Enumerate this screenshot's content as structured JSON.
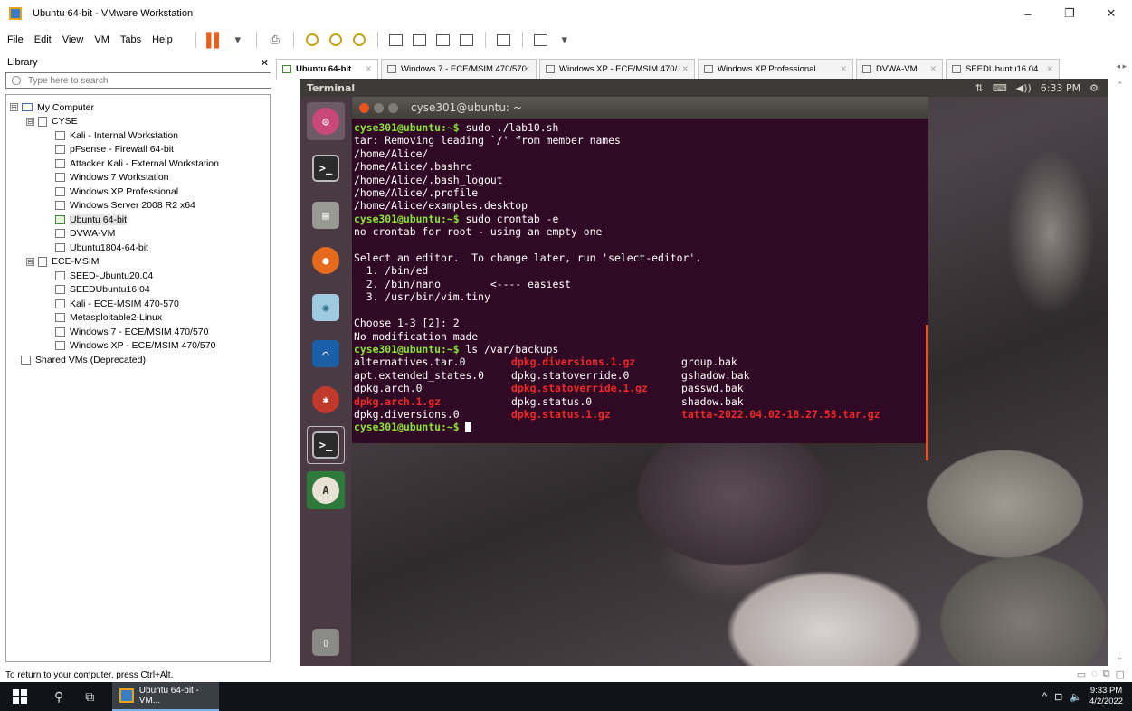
{
  "window": {
    "title": "Ubuntu 64-bit - VMware Workstation",
    "minimize": "–",
    "maximize": "❐",
    "close": "✕"
  },
  "menubar": {
    "items": [
      "File",
      "Edit",
      "View",
      "VM",
      "Tabs",
      "Help"
    ],
    "dropdown_arrow": "▾"
  },
  "library": {
    "title": "Library",
    "close": "✕",
    "search_placeholder": "Type here to search",
    "tree": [
      {
        "label": "My Computer",
        "expander": "⊟"
      },
      {
        "label": "CYSE",
        "expander": "⊟"
      },
      {
        "label": "Kali - Internal Workstation"
      },
      {
        "label": "pFsense - Firewall 64-bit"
      },
      {
        "label": "Attacker Kali - External Workstation"
      },
      {
        "label": "Windows 7 Workstation"
      },
      {
        "label": "Windows XP Professional"
      },
      {
        "label": "Windows Server 2008 R2 x64"
      },
      {
        "label": "Ubuntu 64-bit"
      },
      {
        "label": "DVWA-VM"
      },
      {
        "label": "Ubuntu1804-64-bit"
      },
      {
        "label": "ECE-MSIM",
        "expander": "⊟"
      },
      {
        "label": "SEED-Ubuntu20.04"
      },
      {
        "label": "SEEDUbuntu16.04"
      },
      {
        "label": "Kali - ECE-MSIM 470-570"
      },
      {
        "label": "Metasploitable2-Linux"
      },
      {
        "label": "Windows 7 - ECE/MSIM 470/570"
      },
      {
        "label": "Windows XP - ECE/MSIM 470/570"
      },
      {
        "label": "Shared VMs (Deprecated)"
      }
    ]
  },
  "tabs": [
    {
      "label": "Ubuntu 64-bit",
      "close": "✕"
    },
    {
      "label": "Windows 7 - ECE/MSIM 470/570",
      "close": "✕"
    },
    {
      "label": "Windows XP - ECE/MSIM 470/...",
      "close": "✕"
    },
    {
      "label": "Windows XP Professional",
      "close": "✕"
    },
    {
      "label": "DVWA-VM",
      "close": "✕"
    },
    {
      "label": "SEEDUbuntu16.04",
      "close": "✕"
    }
  ],
  "tab_scroll": "◂ ▸",
  "guest": {
    "panel_title": "Terminal",
    "indicators": {
      "network": "⇅",
      "keyboard": "⌨",
      "volume": "◀))",
      "time": "6:33 PM",
      "settings": "⚙"
    },
    "terminal_title": "cyse301@ubuntu: ~",
    "prompt": "cyse301@ubuntu:~$",
    "lines": {
      "cmd1": " sudo ./lab10.sh",
      "o1": "tar: Removing leading `/' from member names",
      "o2": "/home/Alice/",
      "o3": "/home/Alice/.bashrc",
      "o4": "/home/Alice/.bash_logout",
      "o5": "/home/Alice/.profile",
      "o6": "/home/Alice/examples.desktop",
      "cmd2": " sudo crontab -e",
      "o7": "no crontab for root - using an empty one",
      "o8": "Select an editor.  To change later, run 'select-editor'.",
      "o9": "  1. /bin/ed",
      "o10": "  2. /bin/nano        <---- easiest",
      "o11": "  3. /usr/bin/vim.tiny",
      "o12": "Choose 1-3 [2]: 2",
      "o13": "No modification made",
      "cmd3": " ls /var/backups"
    },
    "ls": [
      [
        "alternatives.tar.0",
        "dpkg.diversions.1.gz",
        "group.bak"
      ],
      [
        "apt.extended_states.0",
        "dpkg.statoverride.0",
        "gshadow.bak"
      ],
      [
        "dpkg.arch.0",
        "dpkg.statoverride.1.gz",
        "passwd.bak"
      ],
      [
        "dpkg.arch.1.gz",
        "dpkg.status.0",
        "shadow.bak"
      ],
      [
        "dpkg.diversions.0",
        "dpkg.status.1.gz",
        "tatta-2022.04.02-18.27.58.tar.gz"
      ]
    ],
    "launcher": [
      "ubuntu-dash",
      "terminal",
      "files",
      "firefox",
      "wireshark",
      "settings",
      "terminal",
      "software-updater",
      "trash"
    ]
  },
  "statusbar": {
    "text": "To return to your computer, press Ctrl+Alt."
  },
  "taskbar": {
    "task_label": "Ubuntu 64-bit - VM...",
    "time": "9:33 PM",
    "date": "4/2/2022",
    "tray_up": "^"
  },
  "colors": {
    "terminal_bg": "#300a24",
    "prompt_green": "#8ae234",
    "archive_red": "#ef2929",
    "launcher_bg": "#4a3a44",
    "accent_orange": "#e95420"
  }
}
